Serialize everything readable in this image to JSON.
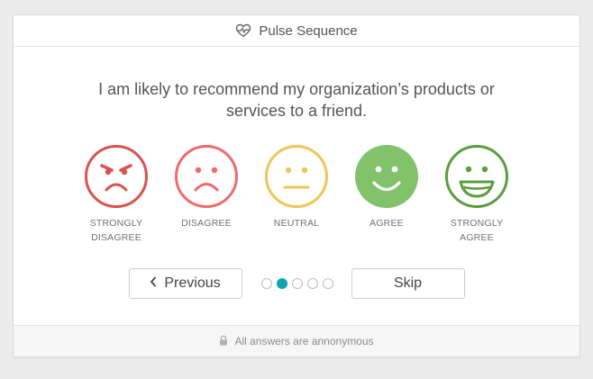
{
  "header": {
    "title": "Pulse Sequence",
    "icon": "heartbeat-icon"
  },
  "question": {
    "text": "I am likely to recommend my organization’s products or\nservices to a friend."
  },
  "options": [
    {
      "label": "STRONGLY\nDISAGREE",
      "face": "very-angry-face-icon",
      "color": "#d9534f"
    },
    {
      "label": "DISAGREE",
      "face": "sad-face-icon",
      "color": "#ee6b6b"
    },
    {
      "label": "NEUTRAL",
      "face": "neutral-face-icon",
      "color": "#f0c659"
    },
    {
      "label": "AGREE",
      "face": "happy-face-icon",
      "color": "#82c26b",
      "selected": true
    },
    {
      "label": "STRONGLY\nAGREE",
      "face": "grinning-face-icon",
      "color": "#5b9e3f"
    }
  ],
  "nav": {
    "previous_label": "Previous",
    "skip_label": "Skip",
    "page_total": 5,
    "page_current": 2
  },
  "footer": {
    "text": "All answers are annonymous",
    "icon": "lock-icon"
  },
  "colors": {
    "accent": "#12a3b2"
  }
}
